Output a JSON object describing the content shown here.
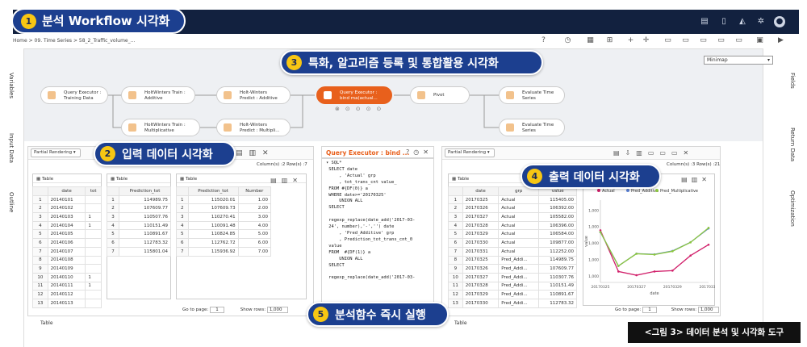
{
  "app": {
    "title": "분석 Workflow 시각화",
    "title_num": "1",
    "breadcrumb": "Home > 09. Time Series > 58_2_Traffic_volume_..."
  },
  "callouts": {
    "c2": {
      "num": "2",
      "text": "입력 데이터 시각화"
    },
    "c3": {
      "num": "3",
      "text": "특화, 알고리즘 등록 및 통합활용 시각화"
    },
    "c4": {
      "num": "4",
      "text": "출력 데이터 시각화"
    },
    "c5": {
      "num": "5",
      "text": "분석함수 즉시 실행"
    }
  },
  "side_left": {
    "variables": "Variables",
    "input_data": "Input Data",
    "outline": "Outline"
  },
  "side_right": {
    "fields": "Fields",
    "return_data": "Return Data",
    "optimization": "Optimization"
  },
  "minimap": "Minimap",
  "workflow": {
    "nodes": {
      "n1": "Query Executor :\nTraining Data",
      "n2": "HoltWinters Train :\nAdditive",
      "n3": "Holt-Winters\nPredict : Additive",
      "n4": "Query Executor :\nbind ma(actual...",
      "n5": "Pivot",
      "n6": "Evaluate Time\nSeries",
      "n7": "HoltWinters Train :\nMultiplicative",
      "n8": "Holt-Winters\nPredict : Multipli...",
      "n9": "Evaluate Time\nSeries"
    }
  },
  "input_panel": {
    "render_mode": "Partial Rendering",
    "columns_info": "Column(s) :2   Row(s) :7",
    "table_label": "Table",
    "t1": {
      "headers": [
        "",
        "date",
        "tot"
      ],
      "rows": [
        [
          "1",
          "20140101",
          ""
        ],
        [
          "2",
          "20140102",
          ""
        ],
        [
          "3",
          "20140103",
          "1"
        ],
        [
          "4",
          "20140104",
          "1"
        ],
        [
          "5",
          "20140105",
          ""
        ],
        [
          "6",
          "20140106",
          ""
        ],
        [
          "7",
          "20140107",
          ""
        ],
        [
          "8",
          "20140108",
          ""
        ],
        [
          "9",
          "20140109",
          ""
        ],
        [
          "10",
          "20140110",
          "1"
        ],
        [
          "11",
          "20140111",
          "1"
        ],
        [
          "12",
          "20140112",
          ""
        ],
        [
          "13",
          "20140113",
          ""
        ]
      ]
    },
    "t2": {
      "headers": [
        "",
        "Prediction_tot"
      ],
      "rows": [
        [
          "1",
          "114989.75"
        ],
        [
          "2",
          "107609.77"
        ],
        [
          "3",
          "110507.76"
        ],
        [
          "4",
          "110151.49"
        ],
        [
          "5",
          "110891.67"
        ],
        [
          "6",
          "112783.32"
        ],
        [
          "7",
          "115801.04"
        ]
      ]
    },
    "t3": {
      "headers": [
        "",
        "Prediction_tot",
        "Number"
      ],
      "rows": [
        [
          "1",
          "115020.01",
          "1.00"
        ],
        [
          "2",
          "107609.73",
          "2.00"
        ],
        [
          "3",
          "110270.41",
          "3.00"
        ],
        [
          "4",
          "110091.48",
          "4.00"
        ],
        [
          "5",
          "110824.85",
          "5.00"
        ],
        [
          "6",
          "112762.72",
          "6.00"
        ],
        [
          "7",
          "115936.92",
          "7.00"
        ]
      ]
    },
    "goto_label": "Go to page:",
    "goto_value": "1",
    "show_rows_label": "Show rows:",
    "show_rows_value": "1,000"
  },
  "query_panel": {
    "title": "Query Executor : bind ...",
    "sql": "▾ SQL*\n SELECT date\n     , 'Actual' grp\n     , tot_trans_cnt value_\n FROM #{DF(0)} a\n WHERE date>='20170325'\n     UNION ALL\n SELECT\n \n regexp_replace(date_add('2017-03-\n 24', number),'-','') date\n     , 'Pred_Additive' grp\n     , Prediction_tot_trans_cnt_0\n value\n FROM  #{DF(1)} a\n     UNION ALL\n SELECT\n \n regexp_replace(date_add('2017-03-"
  },
  "output_panel": {
    "render_mode": "Partial Rendering",
    "columns_info": "Column(s) :3   Row(s) :21",
    "table_label": "Table",
    "t1": {
      "headers": [
        "",
        "date",
        "grp",
        "value"
      ],
      "rows": [
        [
          "1",
          "20170325",
          "Actual",
          "115405.00"
        ],
        [
          "2",
          "20170326",
          "Actual",
          "106392.00"
        ],
        [
          "3",
          "20170327",
          "Actual",
          "105582.00"
        ],
        [
          "4",
          "20170328",
          "Actual",
          "106396.00"
        ],
        [
          "5",
          "20170329",
          "Actual",
          "106584.00"
        ],
        [
          "6",
          "20170330",
          "Actual",
          "109877.00"
        ],
        [
          "7",
          "20170331",
          "Actual",
          "112252.00"
        ],
        [
          "8",
          "20170325",
          "Pred_Addi...",
          "114989.75"
        ],
        [
          "9",
          "20170326",
          "Pred_Addi...",
          "107609.77"
        ],
        [
          "10",
          "20170327",
          "Pred_Addi...",
          "110307.76"
        ],
        [
          "11",
          "20170328",
          "Pred_Addi...",
          "110151.49"
        ],
        [
          "12",
          "20170329",
          "Pred_Addi...",
          "110891.67"
        ],
        [
          "13",
          "20170330",
          "Pred_Addi...",
          "112783.32"
        ]
      ]
    },
    "goto_label": "Go to page:",
    "goto_value": "1",
    "show_rows_label": "Show rows:",
    "show_rows_value": "1,000",
    "table_tab": "Table"
  },
  "bottom": {
    "table_tab_left": "Table",
    "table_tab_right": "Table"
  },
  "caption": "<그림 3> 데이터 분석 및 시각화 도구",
  "colors": {
    "navy": "#12213f",
    "callout_blue": "#1c3f8f",
    "badge_yellow": "#f7c613",
    "active_node": "#e8601c",
    "actual": "#d11f6a",
    "pred_additive": "#5b82d8",
    "pred_multiplicative": "#8cc63f"
  },
  "chart_data": {
    "type": "line",
    "x": [
      "20170325",
      "20170326",
      "20170327",
      "20170328",
      "20170329",
      "20170330",
      "20170331"
    ],
    "xtick_labels": [
      "20170325",
      "20170327",
      "20170329",
      "20170331"
    ],
    "series": [
      {
        "name": "Actual",
        "values": [
          115405,
          106392,
          105582,
          106396,
          106584,
          109877,
          112252
        ]
      },
      {
        "name": "Pred_Additive",
        "values": [
          114989.75,
          107609.77,
          110307.76,
          110151.49,
          110891.67,
          112783.32,
          115801.04
        ]
      },
      {
        "name": "Pred_Multiplicative",
        "values": [
          115020.01,
          107609.73,
          110270.41,
          110091.48,
          110824.85,
          112762.72,
          115936.92
        ]
      }
    ],
    "yticks": [
      "1,000",
      "1,000",
      "1,000",
      "1,000",
      "1,000"
    ],
    "ylim": [
      104000,
      122000
    ],
    "ylabel": "value",
    "xlabel": "date",
    "legend": "top",
    "grid": false
  }
}
